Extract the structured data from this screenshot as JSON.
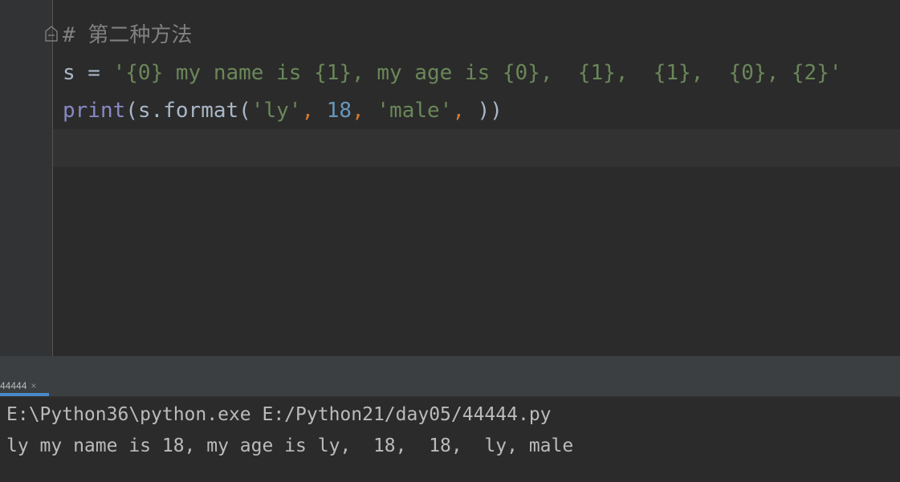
{
  "editor": {
    "line1": {
      "hash": "#",
      "text": "第二种方法"
    },
    "line2": {
      "var": "s",
      "eq": " = ",
      "str": "'{0} my name is {1}, my age is {0},  {1},  {1},  {0}, {2}'"
    },
    "line3": {
      "func": "print",
      "open": "(s.format(",
      "arg1": "'ly'",
      "comma1": ", ",
      "arg2": "18",
      "comma2": ", ",
      "arg3": "'male'",
      "comma3": ", ",
      "close": "))"
    }
  },
  "run_panel": {
    "tab_label": "44444",
    "tab_close": "×",
    "console_lines": [
      "E:\\Python36\\python.exe E:/Python21/day05/44444.py",
      "ly my name is 18, my age is ly,  18,  18,  ly, male"
    ]
  },
  "colors": {
    "background": "#2b2b2b",
    "comment": "#808080",
    "string": "#6a8759",
    "number": "#6897bb",
    "keyword": "#cc7832",
    "builtin": "#8888c6",
    "text": "#a9b7c6",
    "tab_accent": "#4a88c7"
  }
}
